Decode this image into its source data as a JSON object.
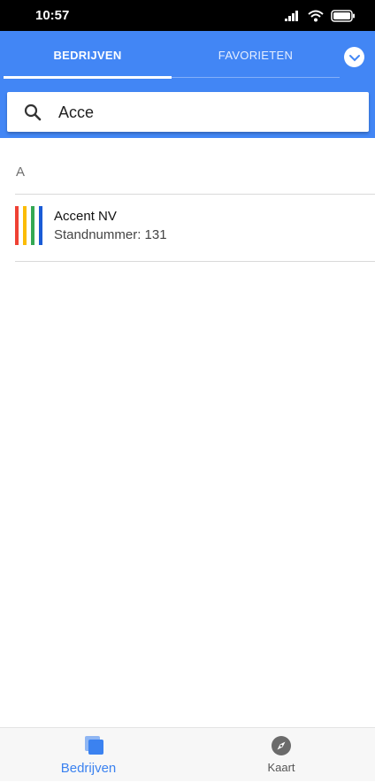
{
  "status_bar": {
    "time": "10:57",
    "icons": [
      "signal-icon",
      "wifi-icon",
      "battery-icon"
    ]
  },
  "tabs": [
    {
      "label": "BEDRIJVEN",
      "selected": true
    },
    {
      "label": "FAVORIETEN",
      "selected": false
    }
  ],
  "dropdown": {
    "icon": "chevron-down-icon"
  },
  "search": {
    "icon": "search-icon",
    "value": "Acce",
    "placeholder": ""
  },
  "list": {
    "section": "A",
    "items": [
      {
        "name": "Accent NV",
        "subtitle": "Standnummer: 131",
        "logo_colors": [
          "#ef4134",
          "#fbbc05",
          "#34a853",
          "#1a5bd6"
        ]
      }
    ]
  },
  "bottom_nav": {
    "items": [
      {
        "label": "Bedrijven",
        "icon": "companies-icon",
        "selected": true
      },
      {
        "label": "Kaart",
        "icon": "compass-icon",
        "selected": false
      }
    ]
  },
  "colors": {
    "primary": "#4286f5",
    "accent_text": "#3b82f0"
  }
}
